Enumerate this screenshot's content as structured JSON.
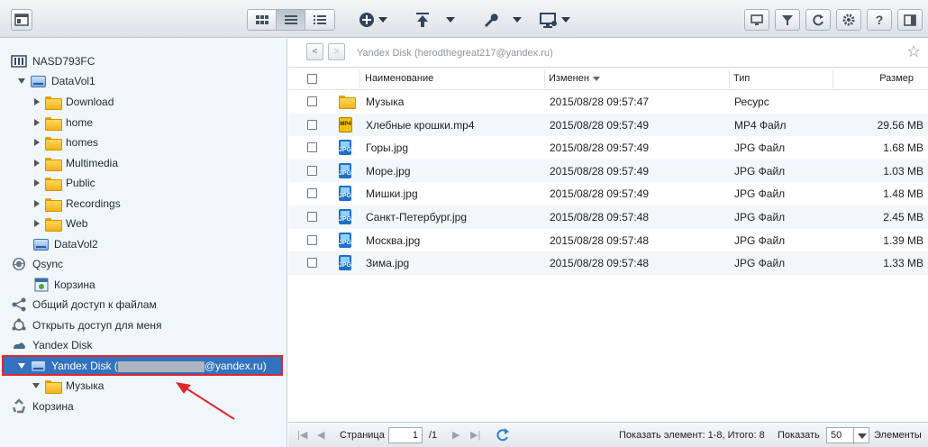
{
  "toolbar": {
    "app_icon": "window-icon",
    "view_buttons": [
      "grid-view-icon",
      "list-view-icon",
      "detail-view-icon"
    ],
    "actions": [
      "add-icon",
      "upload-icon",
      "tools-icon",
      "remote-icon"
    ],
    "right_buttons": [
      "monitor-icon",
      "filter-icon",
      "refresh-icon",
      "gear-icon",
      "help-icon",
      "panel-icon"
    ],
    "help_label": "?"
  },
  "sidebar": {
    "nas": "NASD793FC",
    "datavol1": "DataVol1",
    "folders": [
      "Download",
      "home",
      "homes",
      "Multimedia",
      "Public",
      "Recordings",
      "Web"
    ],
    "datavol2": "DataVol2",
    "qsync": "Qsync",
    "qsync_trash": "Корзина",
    "share_my_files": "Общий доступ к файлам",
    "shared_with_me": "Открыть доступ для меня",
    "yandex": "Yandex Disk",
    "yandex_account_prefix": "Yandex Disk (",
    "yandex_account_suffix": "@yandex.ru)",
    "yandex_child": "Музыка",
    "trash": "Корзина"
  },
  "breadcrumb": {
    "back": "<",
    "forward": ">",
    "path": "Yandex Disk (herodthegreat217@yandex.ru)"
  },
  "table": {
    "headers": {
      "name": "Наименование",
      "modified": "Изменен",
      "type": "Тип",
      "size": "Размер"
    },
    "rows": [
      {
        "icon": "folder",
        "name": "Музыка",
        "modified": "2015/08/28 09:57:47",
        "type": "Ресурс",
        "size": ""
      },
      {
        "icon": "mp4",
        "name": "Хлебные крошки.mp4",
        "modified": "2015/08/28 09:57:49",
        "type": "MP4 Файл",
        "size": "29.56 MB"
      },
      {
        "icon": "jpg",
        "name": "Горы.jpg",
        "modified": "2015/08/28 09:57:49",
        "type": "JPG Файл",
        "size": "1.68 MB"
      },
      {
        "icon": "jpg",
        "name": "Море.jpg",
        "modified": "2015/08/28 09:57:49",
        "type": "JPG Файл",
        "size": "1.03 MB"
      },
      {
        "icon": "jpg",
        "name": "Мишки.jpg",
        "modified": "2015/08/28 09:57:49",
        "type": "JPG Файл",
        "size": "1.48 MB"
      },
      {
        "icon": "jpg",
        "name": "Санкт-Петербург.jpg",
        "modified": "2015/08/28 09:57:48",
        "type": "JPG Файл",
        "size": "2.45 MB"
      },
      {
        "icon": "jpg",
        "name": "Москва.jpg",
        "modified": "2015/08/28 09:57:48",
        "type": "JPG Файл",
        "size": "1.39 MB"
      },
      {
        "icon": "jpg",
        "name": "Зима.jpg",
        "modified": "2015/08/28 09:57:48",
        "type": "JPG Файл",
        "size": "1.33 MB"
      }
    ]
  },
  "pager": {
    "page_label": "Страница",
    "page_value": "1",
    "page_total": "/1",
    "showing": "Показать элемент: 1-8, Итого: 8",
    "show_label": "Показать",
    "per_page": "50",
    "items_label": "Элементы"
  },
  "colors": {
    "selection": "#3273bf",
    "highlight_border": "#e0262e",
    "arrow": "#e0262e"
  }
}
